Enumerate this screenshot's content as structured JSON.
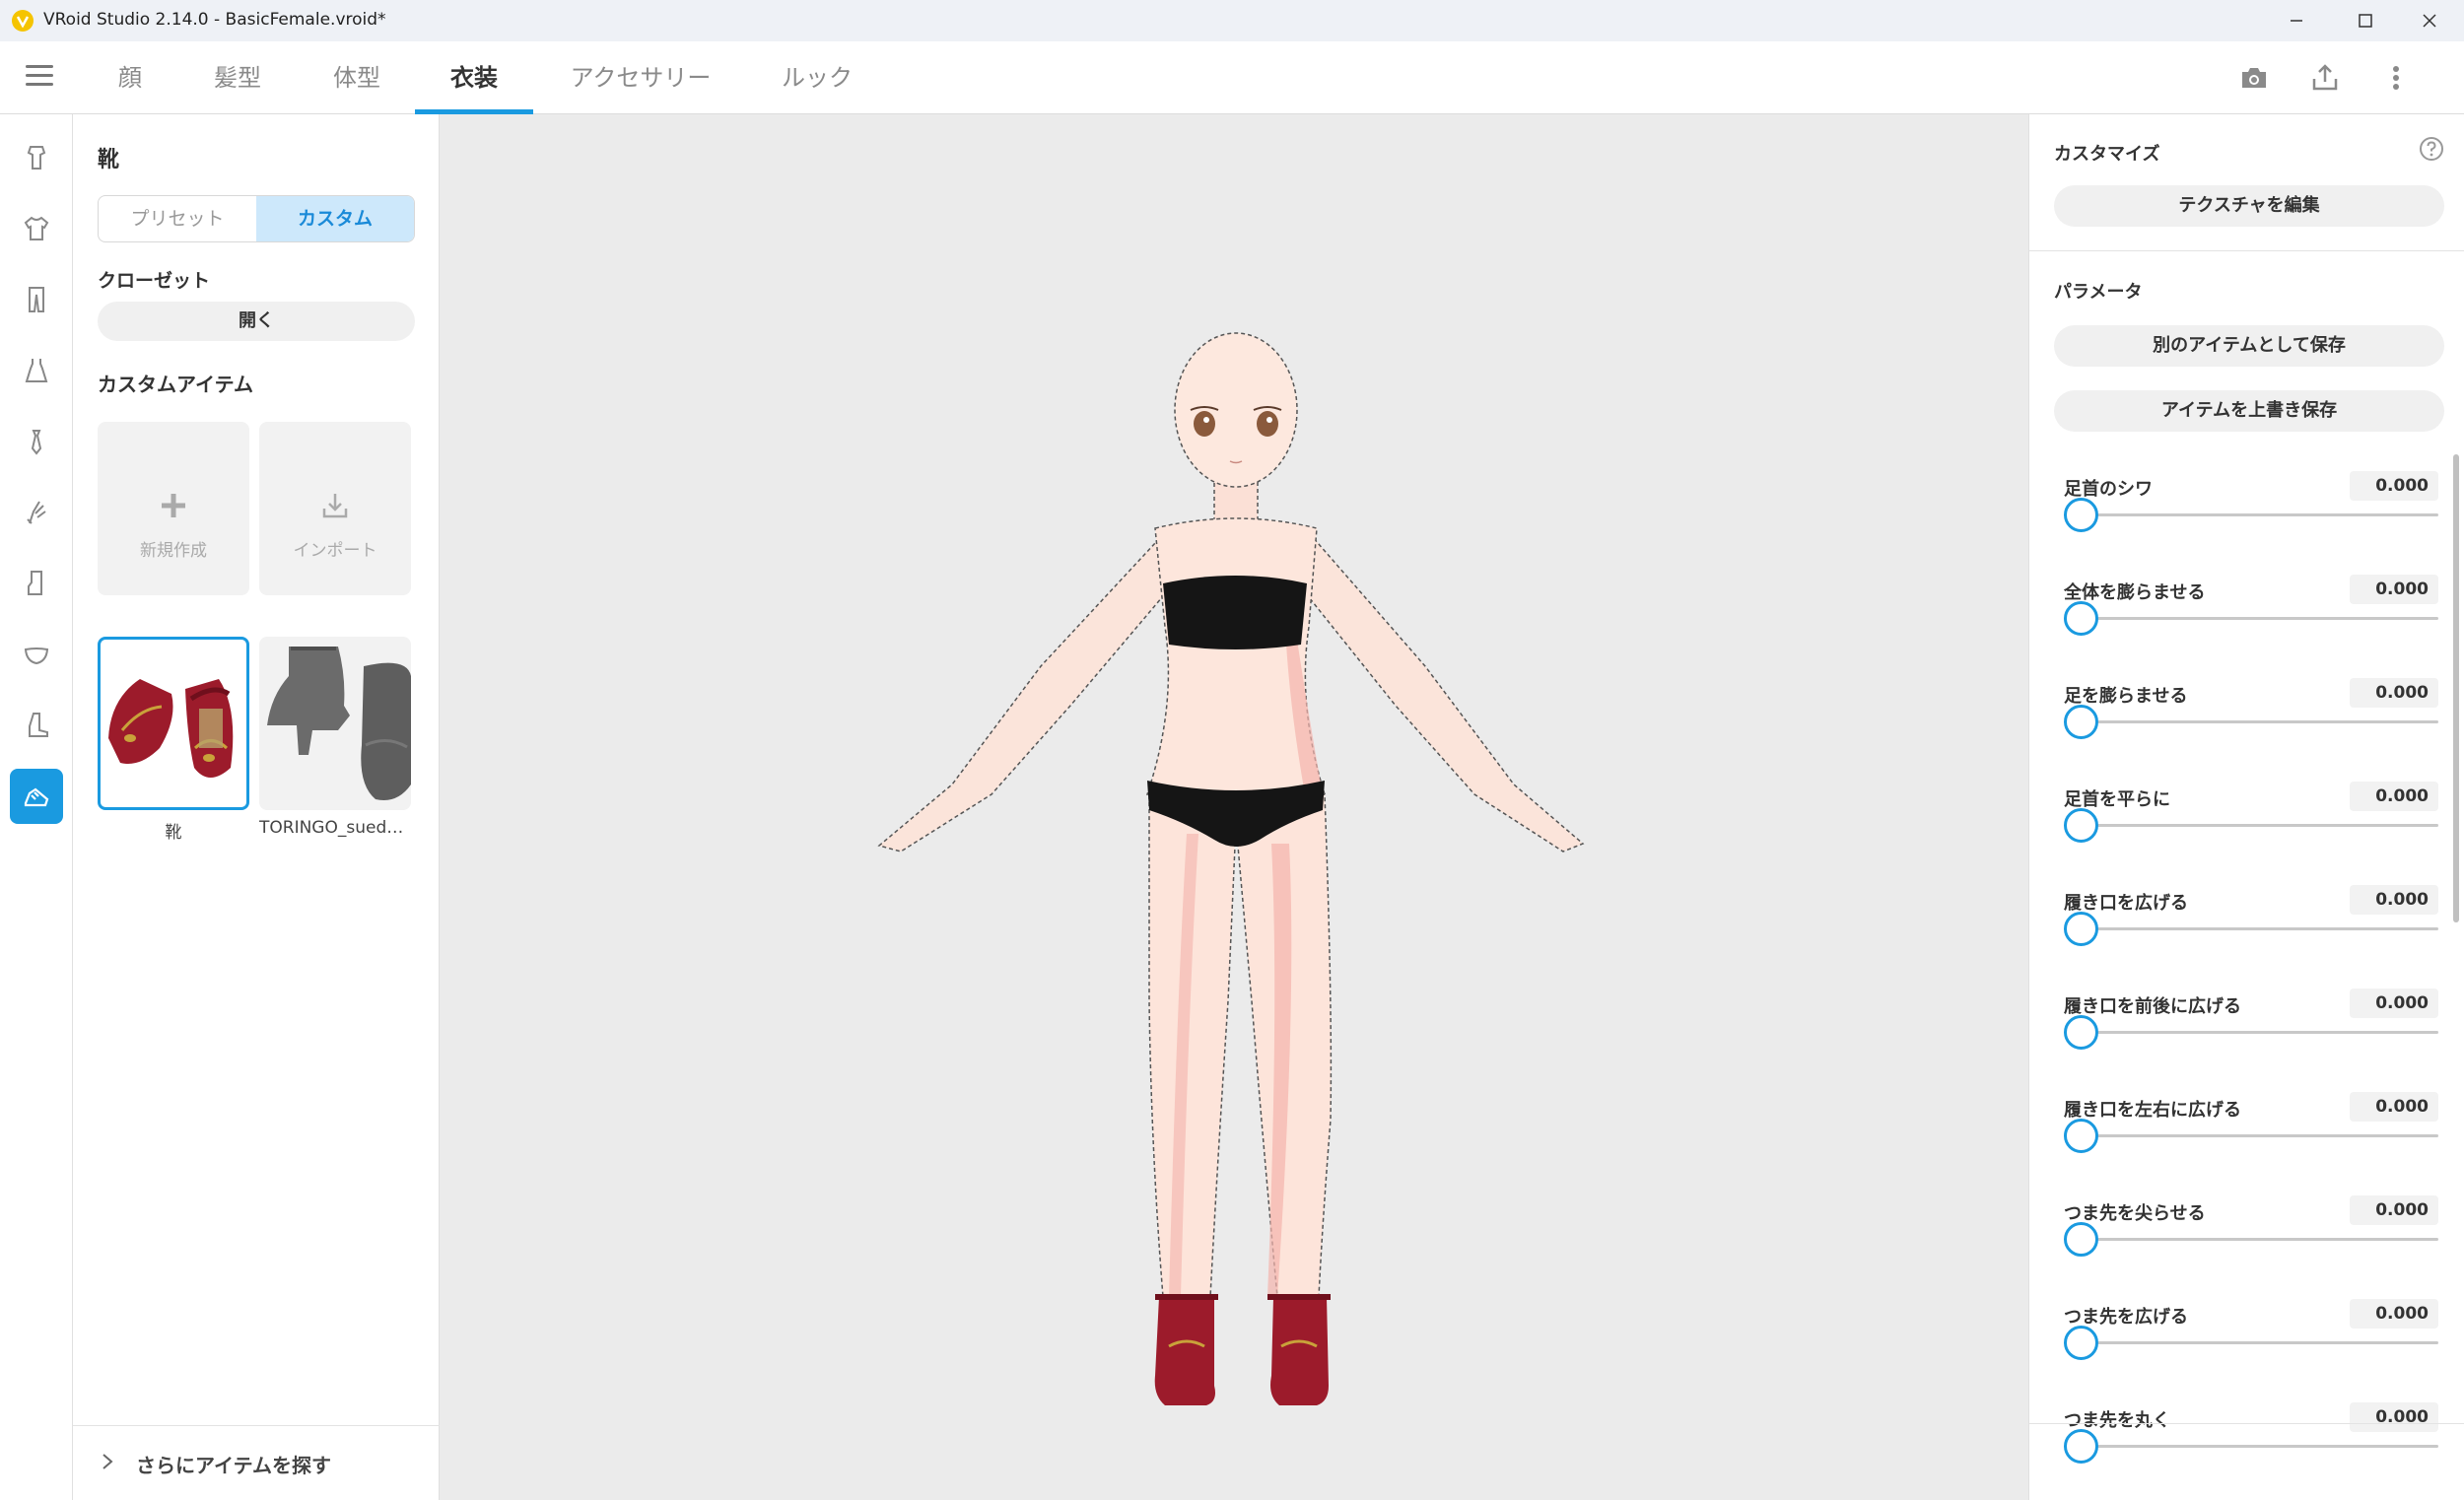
{
  "window": {
    "title": "VRoid Studio 2.14.0 - BasicFemale.vroid*"
  },
  "nav": {
    "tabs": [
      {
        "label": "顔"
      },
      {
        "label": "髪型"
      },
      {
        "label": "体型"
      },
      {
        "label": "衣装"
      },
      {
        "label": "アクセサリー"
      },
      {
        "label": "ルック"
      }
    ],
    "active_tab": "衣装"
  },
  "rail": {
    "items": [
      "hat",
      "top",
      "pants",
      "onepiece",
      "necktie",
      "gloves",
      "socks",
      "bra",
      "boots",
      "shoes"
    ],
    "active": "shoes"
  },
  "left": {
    "title": "靴",
    "segment": {
      "preset": "プリセット",
      "custom": "カスタム"
    },
    "closet_label": "クローゼット",
    "open_label": "開く",
    "custom_items_label": "カスタムアイテム",
    "new_label": "新規作成",
    "import_label": "インポート",
    "items": [
      {
        "caption": "靴"
      },
      {
        "caption": "TORINGO_suede_boots"
      }
    ],
    "more_label": "さらにアイテムを探す"
  },
  "right": {
    "customize_label": "カスタマイズ",
    "edit_texture_label": "テクスチャを編集",
    "parameters_label": "パラメータ",
    "save_as_new_label": "別のアイテムとして保存",
    "overwrite_label": "アイテムを上書き保存",
    "params": [
      {
        "name": "足首のシワ",
        "value": "0.000"
      },
      {
        "name": "全体を膨らませる",
        "value": "0.000"
      },
      {
        "name": "足を膨らませる",
        "value": "0.000"
      },
      {
        "name": "足首を平らに",
        "value": "0.000"
      },
      {
        "name": "履き口を広げる",
        "value": "0.000"
      },
      {
        "name": "履き口を前後に広げる",
        "value": "0.000"
      },
      {
        "name": "履き口を左右に広げる",
        "value": "0.000"
      },
      {
        "name": "つま先を尖らせる",
        "value": "0.000"
      },
      {
        "name": "つま先を広げる",
        "value": "0.000"
      },
      {
        "name": "つま先を丸く",
        "value": "0.000"
      }
    ]
  },
  "colors": {
    "accent": "#1a9ae0",
    "viewport_bg": "#ebebeb"
  }
}
